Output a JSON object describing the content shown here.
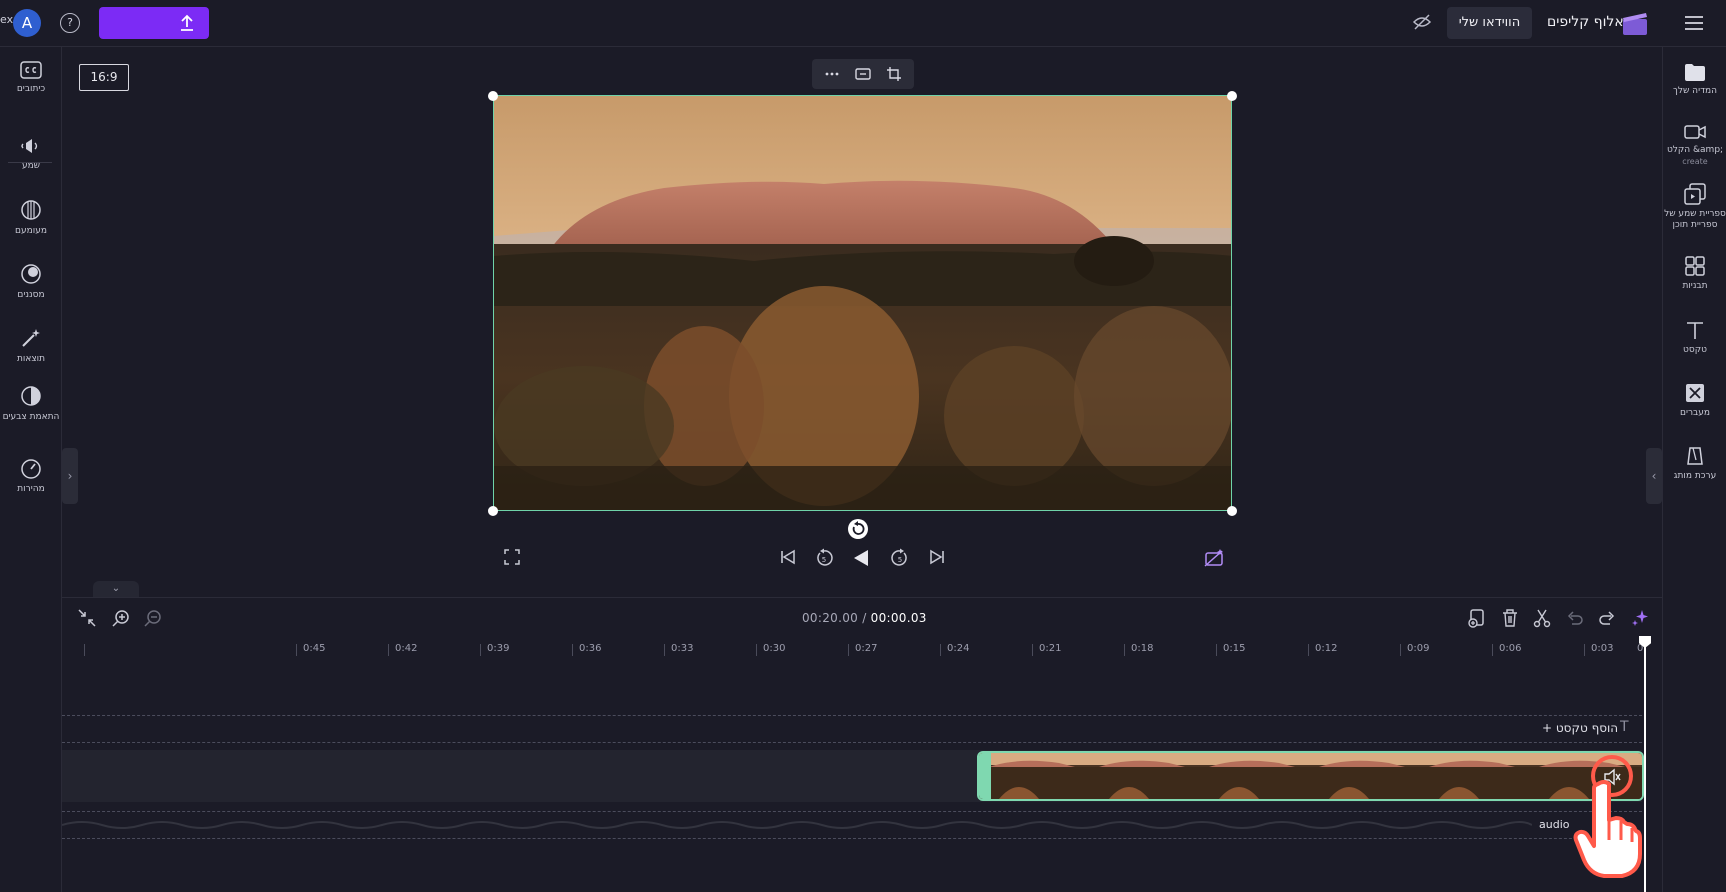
{
  "topbar": {
    "avatar_initial": "A",
    "avatar_edge_text": "ex",
    "help_glyph": "?",
    "export_label": "",
    "my_videos_label": "הווידאו שלי",
    "app_name": "אלוף קליפים"
  },
  "left_tools": [
    {
      "label": "כיתובים",
      "icon": "captions-icon"
    },
    {
      "label": "שמע",
      "icon": "audio-icon"
    },
    {
      "label": "מעומעם",
      "icon": "fade-icon"
    },
    {
      "label": "מסננים",
      "icon": "filters-icon"
    },
    {
      "label": "תוצאות",
      "icon": "effects-icon"
    },
    {
      "label": "התאמת צבעים",
      "icon": "color-adjust-icon"
    },
    {
      "label": "מהירות",
      "icon": "speed-icon"
    }
  ],
  "right_tools": [
    {
      "label": "המדיה שלך",
      "sub": "",
      "icon": "folder-icon"
    },
    {
      "label": "הקלט &amp;",
      "sub": "create",
      "icon": "record-icon"
    },
    {
      "label": "ספריית שמע של ספריית תוכן",
      "sub": "",
      "icon": "content-library-icon"
    },
    {
      "label": "תבניות",
      "sub": "",
      "icon": "templates-icon"
    },
    {
      "label": "טקסט",
      "sub": "",
      "icon": "text-icon"
    },
    {
      "label": "מעברים",
      "sub": "",
      "icon": "transitions-icon"
    },
    {
      "label": "ערכת מותג",
      "sub": "",
      "icon": "brand-kit-icon"
    }
  ],
  "stage": {
    "aspect_ratio": "16:9"
  },
  "timeline": {
    "current_time": "00:00.03",
    "separator": " / ",
    "total_time": "00:20.00",
    "ruler_labels": [
      "0",
      "0:03",
      "0:06",
      "0:09",
      "0:12",
      "0:15",
      "0:18",
      "0:21",
      "0:24",
      "0:27",
      "0:30",
      "0:33",
      "0:36",
      "0:39",
      "0:42",
      "0:45"
    ],
    "add_text_label": "הוסף טקסט",
    "add_text_plus": "+",
    "audio_track_label": "audio"
  }
}
